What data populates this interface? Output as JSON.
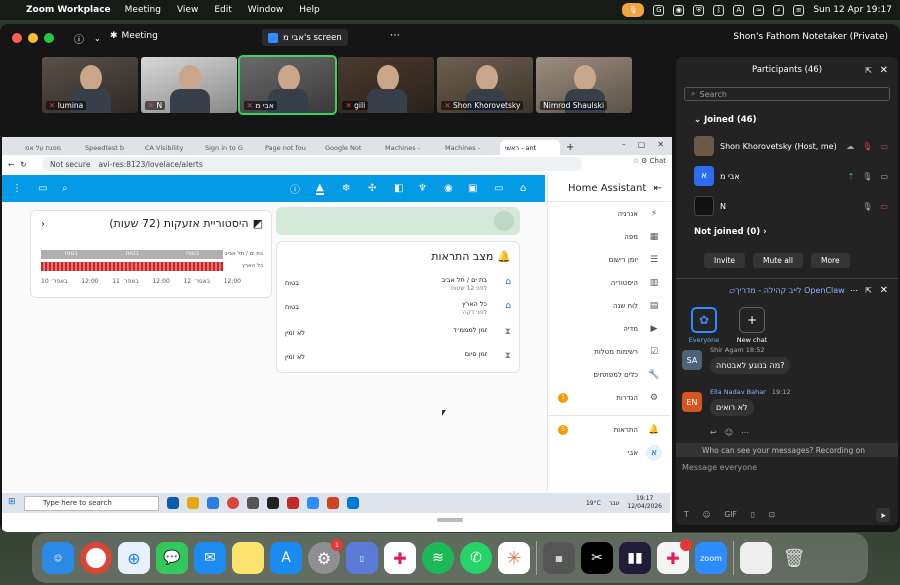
{
  "menubar": {
    "app": "Zoom Workplace",
    "items": [
      "Meeting",
      "View",
      "Edit",
      "Window",
      "Help"
    ],
    "datetime": "Sun 12 Apr  19:17"
  },
  "zoom": {
    "title": "Meeting",
    "share_label": "אבי מ's screen",
    "notetaker": "Shon's Fathom Notetaker (Private)",
    "thumbnails": [
      {
        "name": "lumina",
        "muted": true
      },
      {
        "name": "N",
        "muted": true
      },
      {
        "name": "אבי מ",
        "muted": true,
        "active": true
      },
      {
        "name": "gili",
        "muted": true
      },
      {
        "name": "Shon Khorovetsky",
        "muted": true
      },
      {
        "name": "Nimrod Shaulski",
        "muted": false
      }
    ]
  },
  "browser": {
    "tabs": [
      "מפגת על אמ",
      "Speedtest b",
      "CA Visibility",
      "Sign in to G",
      "Page not fou",
      "Google Not",
      "Machines -",
      "Machines -",
      "ראשי - ant"
    ],
    "url": "avi-res:8123/lovelace/alerts",
    "not_secure": "Not secure",
    "chat_label": "Chat"
  },
  "ha": {
    "sidebar_title": "Home Assistant",
    "sidebar": [
      "אנרגיה",
      "מפה",
      "יומן רישום",
      "היסטוריה",
      "לוח שנה",
      "מדיה",
      "רשימות מטלות",
      "כלים למפתחים",
      "הגדרות"
    ],
    "notifications_label": "התראות",
    "notifications_count": "5",
    "settings_badge": "1",
    "user": "אבי",
    "user_initial": "א",
    "history_title": "היסטוריית אזעקות (72 שעות)",
    "history_rows": [
      "בת ים / תל אביב",
      "כל הארץ"
    ],
    "history_bar1": [
      "בטוח",
      "בטוח",
      "בטוח"
    ],
    "history_bar2": "בטוח",
    "history_ticks": [
      "10 באפר׳",
      "12:00",
      "11 באפר׳",
      "12:00",
      "12 באפר׳",
      "12:00"
    ],
    "status_title": "מצב התראות",
    "status_rows": [
      {
        "name": "בת ים / תל אביב",
        "sub": "לפני 12 שעות",
        "state": "בטוח"
      },
      {
        "name": "כל הארץ",
        "sub": "לפני דקה",
        "state": "בטוח"
      },
      {
        "name": "זמן למממ׳ד",
        "sub": "",
        "state": "לא זמין"
      },
      {
        "name": "זמן סיום",
        "sub": "",
        "state": "לא זמין"
      }
    ]
  },
  "taskbar": {
    "search": "Type here to search",
    "temp": "19°C",
    "time": "19:17",
    "date": "12/04/2026",
    "lang": "עבר"
  },
  "participants": {
    "title": "Participants (46)",
    "search": "Search",
    "joined": "Joined (46)",
    "people": [
      {
        "name": "Shon Khorovetsky (Host, me)",
        "initial": ""
      },
      {
        "name": "אבי מ",
        "initial": "א"
      },
      {
        "name": "N",
        "initial": ""
      }
    ],
    "not_joined": "Not joined (0)",
    "invite": "Invite",
    "mute_all": "Mute all",
    "more": "More"
  },
  "chat": {
    "title": "לייב קהילה - מדריך OpenClaw",
    "everyone": "Everyone",
    "new_chat": "New chat",
    "messages": [
      {
        "author": "Shir Agam",
        "time": "18:52",
        "text": "מה בנוגע לאבטחה?",
        "initials": "SA"
      },
      {
        "author": "Ella Nadav Bahar",
        "time": "19:12",
        "text": "לא רואים",
        "initials": "EN"
      }
    ],
    "info": "Who can see your messages? Recording on",
    "placeholder": "Message everyone"
  },
  "dock": {
    "zoom_label": "zoom",
    "badges": {
      "settings": "1",
      "slack_alt": "3"
    }
  }
}
